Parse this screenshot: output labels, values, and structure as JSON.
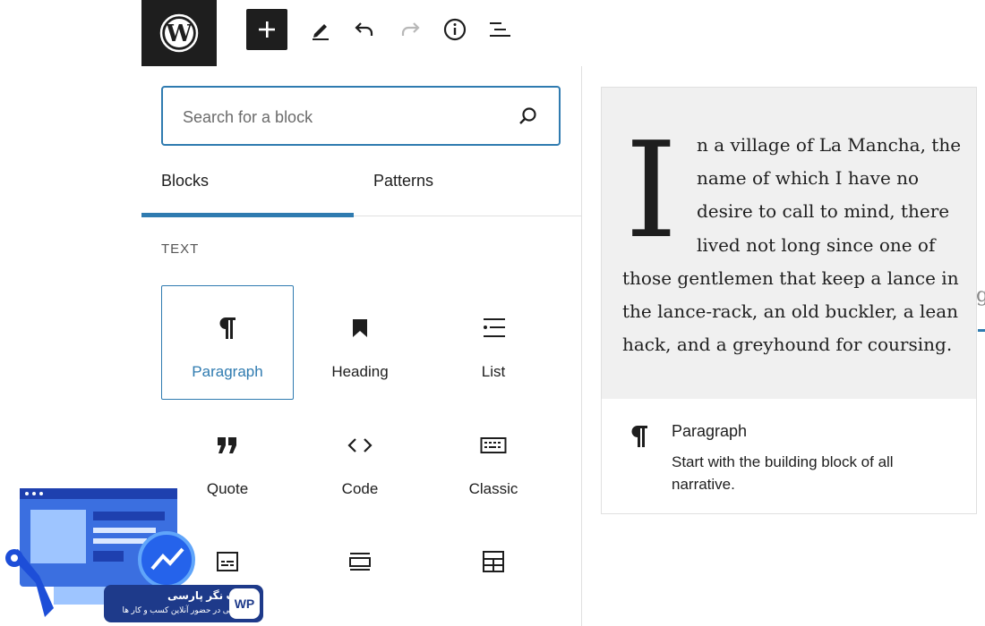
{
  "toolbar": {
    "add_block": "add",
    "tools": "tools",
    "undo": "undo",
    "redo": "redo",
    "details": "details",
    "outline": "list view"
  },
  "inserter": {
    "search": {
      "placeholder": "Search for a block",
      "value": ""
    },
    "tabs": [
      {
        "label": "Blocks",
        "active": true
      },
      {
        "label": "Patterns",
        "active": false
      }
    ],
    "category": "TEXT",
    "blocks": [
      {
        "label": "Paragraph",
        "icon": "paragraph-icon",
        "selected": true
      },
      {
        "label": "Heading",
        "icon": "bookmark-icon",
        "selected": false
      },
      {
        "label": "List",
        "icon": "list-icon",
        "selected": false
      },
      {
        "label": "Quote",
        "icon": "quote-icon",
        "selected": false
      },
      {
        "label": "Code",
        "icon": "code-icon",
        "selected": false
      },
      {
        "label": "Classic",
        "icon": "keyboard-icon",
        "selected": false
      },
      {
        "label": "",
        "icon": "preformatted-icon",
        "selected": false
      },
      {
        "label": "",
        "icon": "pullquote-icon",
        "selected": false
      },
      {
        "label": "",
        "icon": "table-icon",
        "selected": false
      }
    ]
  },
  "preview": {
    "dropcap": "I",
    "lines": [
      "n a village of La Mancha, the",
      "name of which I have no",
      "desire to call to mind, there",
      "lived not long since one of",
      "those gentlemen that keep a lance in",
      "the lance-rack, an old buckler, a lean",
      "hack, and a greyhound for coursing."
    ],
    "block_title": "Paragraph",
    "block_description": "Start with the building block of all narrative."
  },
  "watermark": {
    "name": "وب نگر پارسی",
    "tagline": "تحولی در حضور آنلاین کسب و کار ها",
    "mark": "WP"
  },
  "colors": {
    "accent": "#2f7bb0",
    "dark": "#1e1e1e",
    "preview_bg": "#f0f0f0"
  }
}
